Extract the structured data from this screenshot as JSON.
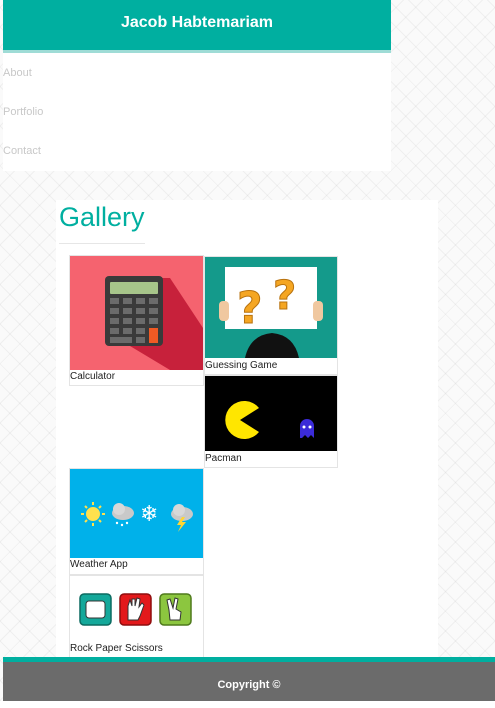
{
  "header": {
    "title": "Jacob Habtemariam"
  },
  "nav": {
    "items": [
      "About",
      "Portfolio",
      "Contact"
    ]
  },
  "gallery": {
    "title": "Gallery",
    "items": [
      {
        "label": "Calculator",
        "icon": "calculator-icon"
      },
      {
        "label": "Guessing Game",
        "icon": "question-sign-icon"
      },
      {
        "label": "Pacman",
        "icon": "pacman-icon"
      },
      {
        "label": "Weather App",
        "icon": "weather-icon"
      },
      {
        "label": "Rock Paper Scissors",
        "icon": "hand-signs-icon"
      }
    ]
  },
  "footer": {
    "text": "Copyright ©"
  },
  "colors": {
    "accent": "#00afa0",
    "footer_bg": "#6b6b6b"
  }
}
